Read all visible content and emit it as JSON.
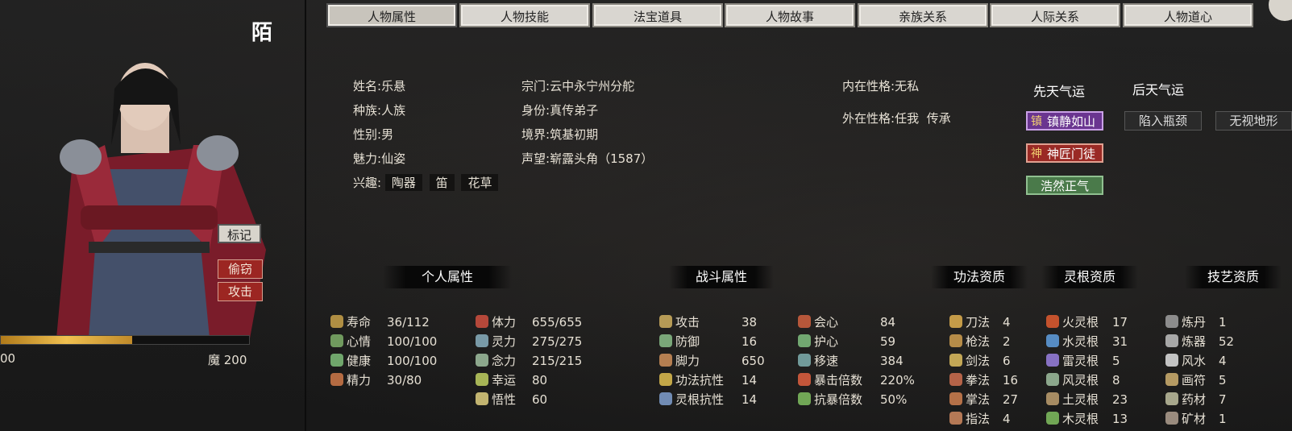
{
  "character": {
    "name": "陌",
    "mark_label": "标记",
    "steal_label": "偷窃",
    "attack_label": "攻击",
    "bar_left_text": "00",
    "bar_right_text": "魔 200",
    "bar_fill_fraction": 0.53
  },
  "tabs": [
    "人物属性",
    "人物技能",
    "法宝道具",
    "人物故事",
    "亲族关系",
    "人际关系",
    "人物道心"
  ],
  "active_tab": 0,
  "info": {
    "name_label": "姓名:",
    "name": "乐悬",
    "race_label": "种族:",
    "race": "人族",
    "gender_label": "性别:",
    "gender": "男",
    "charm_label": "魅力:",
    "charm": "仙姿",
    "hobby_label": "兴趣:",
    "hobbies": [
      "陶器",
      "笛",
      "花草"
    ],
    "sect_label": "宗门:",
    "sect": "云中永宁州分舵",
    "identity_label": "身份:",
    "identity": "真传弟子",
    "realm_label": "境界:",
    "realm": "筑基初期",
    "fame_label": "声望:",
    "fame": "崭露头角（1587）",
    "inner_label": "内在性格:",
    "inner": "无私",
    "outer_label": "外在性格:",
    "outer": [
      "任我",
      "传承"
    ]
  },
  "fate": {
    "innate_title": "先天气运",
    "acquired_title": "后天气运",
    "innate": [
      {
        "text": "镇静如山",
        "glyph": "镇",
        "style": "purple"
      },
      {
        "text": "神匠门徒",
        "glyph": "神",
        "style": "red"
      },
      {
        "text": "浩然正气",
        "style": "green"
      }
    ],
    "acquired": [
      "陷入瓶颈",
      "无视地形"
    ]
  },
  "sections": {
    "personal": "个人属性",
    "combat": "战斗属性",
    "martial": "功法资质",
    "root": "灵根资质",
    "craft": "技艺资质"
  },
  "personal_a": [
    {
      "label": "寿命",
      "value": "36/112",
      "icon": "figure-icon",
      "color": "#c9a24a"
    },
    {
      "label": "心情",
      "value": "100/100",
      "icon": "sprout-icon",
      "color": "#7fb06a"
    },
    {
      "label": "健康",
      "value": "100/100",
      "icon": "cross-icon",
      "color": "#7fc07a"
    },
    {
      "label": "精力",
      "value": "30/80",
      "icon": "flex-icon",
      "color": "#d07a4a"
    }
  ],
  "personal_b": [
    {
      "label": "体力",
      "value": "655/655",
      "icon": "heart-icon",
      "color": "#d05040"
    },
    {
      "label": "灵力",
      "value": "275/275",
      "icon": "wave-icon",
      "color": "#8ab0c0"
    },
    {
      "label": "念力",
      "value": "215/215",
      "icon": "eye-icon",
      "color": "#a0c0a0"
    },
    {
      "label": "幸运",
      "value": "80",
      "icon": "moon-icon",
      "color": "#c0d060"
    },
    {
      "label": "悟性",
      "value": "60",
      "icon": "star-icon",
      "color": "#e0d080"
    }
  ],
  "combat_a": [
    {
      "label": "攻击",
      "value": "38",
      "icon": "swords-icon",
      "color": "#d0b060"
    },
    {
      "label": "防御",
      "value": "16",
      "icon": "shield-icon",
      "color": "#8ac08a"
    },
    {
      "label": "脚力",
      "value": "650",
      "icon": "foot-icon",
      "color": "#d0905a"
    },
    {
      "label": "功法抗性",
      "value": "14",
      "icon": "arc-icon",
      "color": "#e0c050"
    },
    {
      "label": "灵根抗性",
      "value": "14",
      "icon": "arc-icon",
      "color": "#80a0d0"
    }
  ],
  "combat_b": [
    {
      "label": "会心",
      "value": "84",
      "icon": "tri-icon",
      "color": "#d06040"
    },
    {
      "label": "护心",
      "value": "59",
      "icon": "heart-shield-icon",
      "color": "#80c080"
    },
    {
      "label": "移速",
      "value": "384",
      "icon": "boot-icon",
      "color": "#80b0b0"
    },
    {
      "label": "暴击倍数",
      "value": "220%",
      "icon": "triangles-icon",
      "color": "#e06040"
    },
    {
      "label": "抗暴倍数",
      "value": "50%",
      "icon": "triangles-down-icon",
      "color": "#80c060"
    }
  ],
  "martial": [
    {
      "label": "刀法",
      "value": "4",
      "icon": "blade-icon",
      "color": "#e0b050"
    },
    {
      "label": "枪法",
      "value": "2",
      "icon": "spear-icon",
      "color": "#d0a050"
    },
    {
      "label": "剑法",
      "value": "6",
      "icon": "sword-icon",
      "color": "#e0c060"
    },
    {
      "label": "拳法",
      "value": "16",
      "icon": "fist-icon",
      "color": "#d07050"
    },
    {
      "label": "掌法",
      "value": "27",
      "icon": "palm-icon",
      "color": "#d08050"
    },
    {
      "label": "指法",
      "value": "4",
      "icon": "finger-icon",
      "color": "#d08a60"
    }
  ],
  "roots": [
    {
      "label": "火灵根",
      "value": "17",
      "icon": "fire-icon",
      "color": "#e05a30"
    },
    {
      "label": "水灵根",
      "value": "31",
      "icon": "drop-icon",
      "color": "#60a0e0"
    },
    {
      "label": "雷灵根",
      "value": "5",
      "icon": "thunder-icon",
      "color": "#9a80e0"
    },
    {
      "label": "风灵根",
      "value": "8",
      "icon": "wind-icon",
      "color": "#a0c0a0"
    },
    {
      "label": "土灵根",
      "value": "23",
      "icon": "mountain-icon",
      "color": "#c0a070"
    },
    {
      "label": "木灵根",
      "value": "13",
      "icon": "leaf-icon",
      "color": "#80c060"
    }
  ],
  "crafts": [
    {
      "label": "炼丹",
      "value": "1",
      "icon": "cauldron-icon",
      "color": "#a0a0a0"
    },
    {
      "label": "炼器",
      "value": "52",
      "icon": "hammer-icon",
      "color": "#c0c0c0"
    },
    {
      "label": "风水",
      "value": "4",
      "icon": "taiji-icon",
      "color": "#e0e0e0"
    },
    {
      "label": "画符",
      "value": "5",
      "icon": "talisman-icon",
      "color": "#d0b070"
    },
    {
      "label": "药材",
      "value": "7",
      "icon": "mushroom-icon",
      "color": "#c0c0a0"
    },
    {
      "label": "矿材",
      "value": "1",
      "icon": "ore-icon",
      "color": "#b0a090"
    }
  ]
}
